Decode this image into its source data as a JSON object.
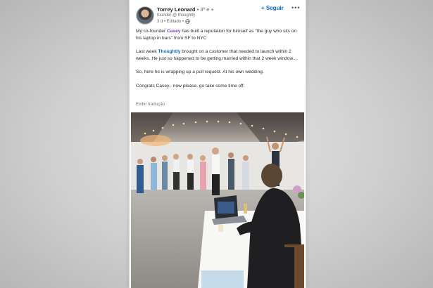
{
  "post": {
    "author_name": "Torrey Leonard",
    "author_degree": "• 3º e +",
    "author_headline": "founder @ thoughtly",
    "post_time": "3 d • Editado •",
    "follow_label": "+ Seguir",
    "more_label": "•••",
    "body_line1_prefix": "My co-founder ",
    "body_line1_mention": "Casey",
    "body_line1_suffix": " has built a reputation for himself as \"the guy who sits on his laptop in bars\" from SF to NYC",
    "body_line2_prefix": "Last week ",
    "body_line2_company": "Thoughtly",
    "body_line2_suffix": " brought on a customer that needed to launch within 2 weeks. He just so happened to be getting married within that 2 week window...",
    "body_line3": "So, here he is wrapping up a pull request. At his own wedding.",
    "body_line4": "Congrats Casey– now please, go take some time off.",
    "translate_label": "Exibir tradução"
  },
  "icons": {
    "globe": "globe-icon",
    "more": "more-icon"
  },
  "colors": {
    "link_blue": "#0a66c2",
    "mention_purple": "#7b3fb8"
  }
}
